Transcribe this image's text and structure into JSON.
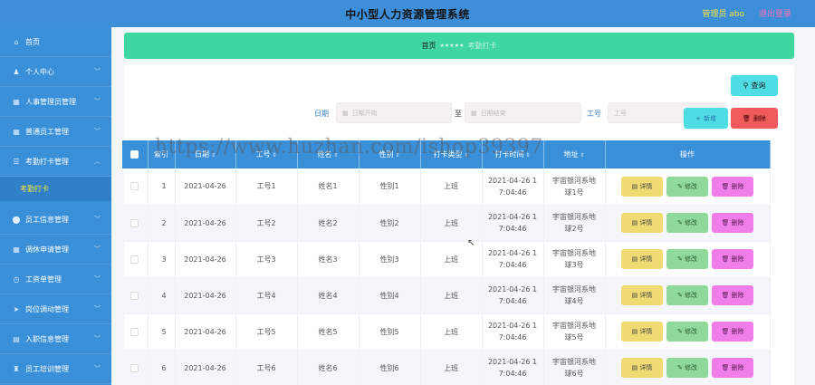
{
  "header": {
    "title": "中小型人力资源管理系统",
    "admin": "管理员 abo",
    "logout": "退出登录"
  },
  "sidebar": {
    "items": [
      {
        "label": "首页",
        "icon": "home-icon",
        "glyph": "⌂",
        "chevron": false
      },
      {
        "label": "个人中心",
        "icon": "user-icon",
        "glyph": "♟",
        "chevron": true
      },
      {
        "label": "人事管理员管理",
        "icon": "grid-icon",
        "glyph": "▦",
        "chevron": true
      },
      {
        "label": "普通员工管理",
        "icon": "grid-icon",
        "glyph": "▦",
        "chevron": true
      },
      {
        "label": "考勤打卡管理",
        "icon": "list-icon",
        "glyph": "☰",
        "chevron": true
      },
      {
        "label": "员工信息管理",
        "icon": "pin-icon",
        "glyph": "⬤",
        "chevron": true
      },
      {
        "label": "调休申请管理",
        "icon": "grid-icon",
        "glyph": "▦",
        "chevron": true
      },
      {
        "label": "工资单管理",
        "icon": "clock-icon",
        "glyph": "◷",
        "chevron": true
      },
      {
        "label": "岗位调动管理",
        "icon": "send-icon",
        "glyph": "➤",
        "chevron": true
      },
      {
        "label": "入职信息管理",
        "icon": "doc-icon",
        "glyph": "▤",
        "chevron": true
      },
      {
        "label": "员工培训管理",
        "icon": "trophy-icon",
        "glyph": "♜",
        "chevron": true
      }
    ],
    "sub_active": "考勤打卡"
  },
  "breadcrumb": {
    "home": "首页",
    "sep": "★★★★★",
    "current": "考勤打卡"
  },
  "filters": {
    "date_label": "日期",
    "start_placeholder": "日期开始",
    "to_label": "至",
    "end_placeholder": "日期结束",
    "worker_label": "工号",
    "worker_placeholder": "工号",
    "search_label": "查询"
  },
  "actions": {
    "add_label": "新增",
    "delete_label": "删除"
  },
  "table": {
    "columns": [
      "索引",
      "日期",
      "工号",
      "姓名",
      "性别",
      "打卡类型",
      "打卡时间",
      "地址",
      "操作"
    ],
    "rows": [
      {
        "index": "1",
        "date": "2021-04-26",
        "worker_no": "工号1",
        "name": "姓名1",
        "gender": "性别1",
        "type": "上班",
        "time_l1": "2021-04-26 1",
        "time_l2": "7:04:46",
        "addr_l1": "宇宙银河系地",
        "addr_l2": "球1号"
      },
      {
        "index": "2",
        "date": "2021-04-26",
        "worker_no": "工号2",
        "name": "姓名2",
        "gender": "性别2",
        "type": "上班",
        "time_l1": "2021-04-26 1",
        "time_l2": "7:04:46",
        "addr_l1": "宇宙银河系地",
        "addr_l2": "球2号"
      },
      {
        "index": "3",
        "date": "2021-04-26",
        "worker_no": "工号3",
        "name": "姓名3",
        "gender": "性别3",
        "type": "上班",
        "time_l1": "2021-04-26 1",
        "time_l2": "7:04:46",
        "addr_l1": "宇宙银河系地",
        "addr_l2": "球3号"
      },
      {
        "index": "4",
        "date": "2021-04-26",
        "worker_no": "工号4",
        "name": "姓名4",
        "gender": "性别4",
        "type": "上班",
        "time_l1": "2021-04-26 1",
        "time_l2": "7:04:46",
        "addr_l1": "宇宙银河系地",
        "addr_l2": "球4号"
      },
      {
        "index": "5",
        "date": "2021-04-26",
        "worker_no": "工号5",
        "name": "姓名5",
        "gender": "性别5",
        "type": "上班",
        "time_l1": "2021-04-26 1",
        "time_l2": "7:04:46",
        "addr_l1": "宇宙银河系地",
        "addr_l2": "球5号"
      },
      {
        "index": "6",
        "date": "2021-04-26",
        "worker_no": "工号6",
        "name": "姓名6",
        "gender": "性别6",
        "type": "上班",
        "time_l1": "2021-04-26 1",
        "time_l2": "7:04:46",
        "addr_l1": "宇宙银河系地",
        "addr_l2": "球6号"
      }
    ],
    "row_actions": {
      "detail": "详情",
      "edit": "修改",
      "delete": "删除"
    }
  },
  "watermark": "https://www.huzhan.com/ishop39397",
  "colors": {
    "primary": "#3a8fd9",
    "breadcrumb": "#3fd7a0",
    "search": "#4fdde5",
    "danger": "#ef5b5b",
    "detail": "#f0db73",
    "edit": "#8fd99a",
    "delete_row": "#f07de8"
  }
}
